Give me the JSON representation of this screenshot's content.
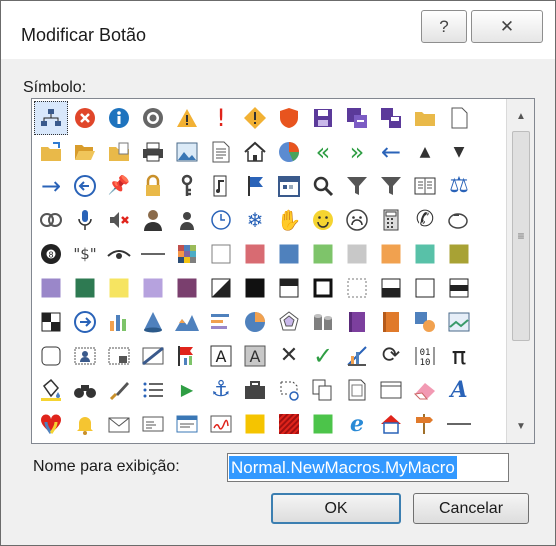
{
  "window": {
    "title": "Modificar Botão",
    "help_label": "?",
    "close_label": "✕"
  },
  "symbol_label": "Símbolo:",
  "display_name_label": "Nome para exibição:",
  "display_name_value": "Normal.NewMacros.MyMacro",
  "buttons": {
    "ok": "OK",
    "cancel": "Cancelar"
  },
  "colors": {
    "accent": "#3399ff",
    "error_red": "#e0462a",
    "info_blue": "#1e73be",
    "warning_yellow": "#f2b134",
    "arrow_green": "#2f9e44"
  },
  "symbols": [
    [
      "org-chart-icon",
      "error-circle-icon",
      "info-circle-icon",
      "record-circle-icon",
      "warning-triangle-icon",
      "exclamation-red-icon",
      "diamond-warning-icon",
      "shield-icon",
      "save-disk-icon",
      "save-as-icon",
      "save-multiple-icon",
      "folder-icon",
      "blank-page-icon",
      "folder-arrow-icon"
    ],
    [
      "open-folder-icon",
      "folder-doc-icon",
      "printer-icon",
      "picture-icon",
      "page-list-icon",
      "home-icon",
      "pie-chart-icon",
      "double-left-green-icon",
      "double-right-green-icon",
      "back-arrow-icon",
      "triangle-up-icon",
      "triangle-down-icon",
      "forward-arrow-icon",
      "back-circle-icon"
    ],
    [
      "pin-icon",
      "lock-icon",
      "key-icon",
      "music-page-icon",
      "flag-icon",
      "calendar-icon",
      "magnifier-icon",
      "filter-icon",
      "filter-add-icon",
      "book-icon",
      "scales-icon",
      "rings-icon",
      "microphone-icon",
      "mute-icon"
    ],
    [
      "user-suit-icon",
      "person-icon",
      "clock-icon",
      "snowflake-icon",
      "hand-icon",
      "smiley-icon",
      "sad-face-icon",
      "calculator-icon",
      "phone-icon",
      "piggy-bank-icon",
      "eight-ball-icon",
      "dollar-quotes-icon",
      "eye-icon",
      "dash-line-icon"
    ],
    [
      "color-grid-icon",
      "white-square-icon",
      "rose-square-icon",
      "blue-square-icon",
      "green-square-icon",
      "gray-square-icon",
      "orange-square-icon",
      "teal-square-icon",
      "olive-square-icon",
      "purple-square-icon",
      "darkgreen-square-icon",
      "yellow-square-icon",
      "lavender-square-icon",
      "plum-square-icon"
    ],
    [
      "half-black-square-icon",
      "black-square-icon",
      "top-bar-square-icon",
      "bold-square-icon",
      "dotted-square-icon",
      "split-square-icon",
      "outline-square-icon",
      "banded-square-icon",
      "checker-square-icon",
      "arrow-circle-icon",
      "bar-chart-icon",
      "cone-icon",
      "mountain-chart-icon",
      "align-left-icon"
    ],
    [
      "pie-icon",
      "spider-chart-icon",
      "cylinder-icon",
      "purple-book-icon",
      "orange-book-icon",
      "shapes-icon",
      "landscape-icon",
      "rounded-square-icon",
      "contact-card-icon",
      "grid-frame-icon",
      "diagonal-icon",
      "flag-chart-icon",
      "text-box-icon",
      "shaded-a-icon"
    ],
    [
      "cross-icon",
      "check-icon",
      "ruler-chart-icon",
      "refresh-icon",
      "binary-icon",
      "pi-icon",
      "paint-bucket-icon",
      "binoculars-icon",
      "brush-icon",
      "list-icon",
      "play-icon",
      "anchor-icon",
      "briefcase-icon",
      "lasso-icon"
    ],
    [
      "copy-icon",
      "document-icon",
      "frame-icon",
      "eraser-icon",
      "script-a-icon",
      "heart-icon",
      "bell-icon",
      "envelope-icon",
      "id-card-icon",
      "memo-icon",
      "signature-icon",
      "gold-square-icon",
      "hatched-red-icon",
      "green-tile-icon"
    ],
    [
      "ie-icon",
      "home-red-icon",
      "signpost-icon",
      "line-icon",
      "sticky-note-icon",
      "gear-doc-icon",
      "clipboard-icon",
      "box-icon",
      "heart-link-icon",
      "camcorder-icon",
      "table-grid-icon",
      "window-icon",
      "cascade-icon",
      "certificate-icon"
    ]
  ]
}
